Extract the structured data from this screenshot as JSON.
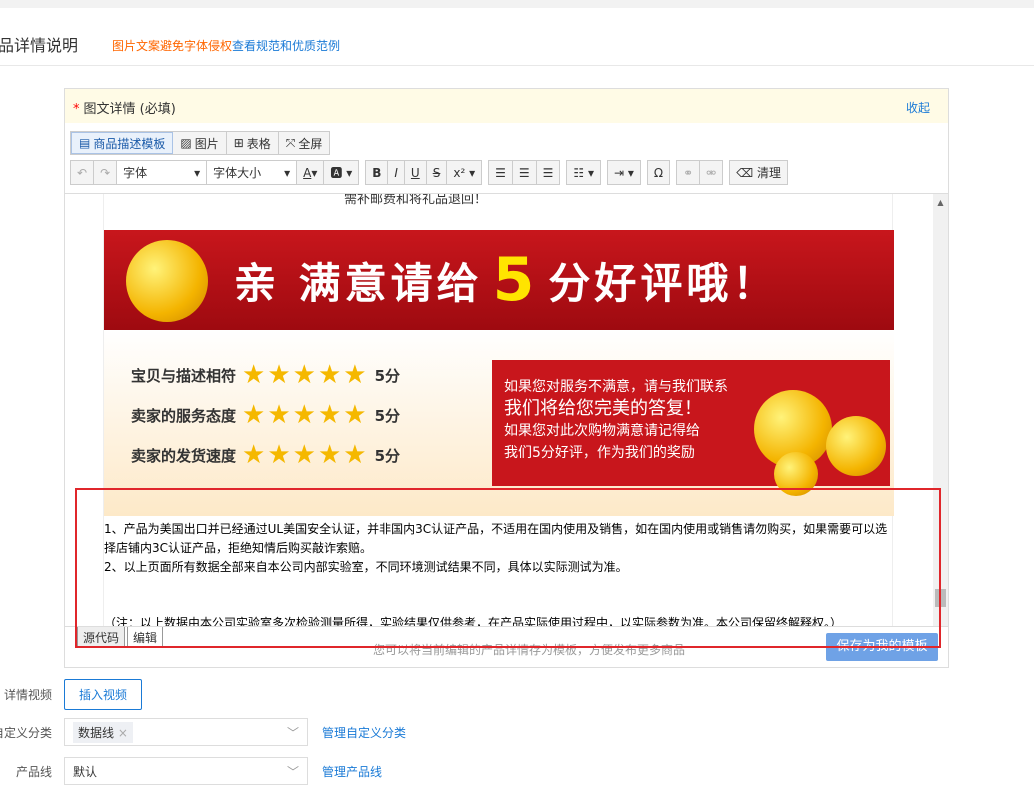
{
  "section": {
    "title": "品详情说明",
    "tip_warning": "图片文案避免字体侵权",
    "tip_link": "查看规范和优质范例"
  },
  "editor": {
    "label": "图文详情 (必填)",
    "required_mark": "*",
    "collapse": "收起",
    "toolbar1": [
      "商品描述模板",
      "图片",
      "表格",
      "全屏"
    ],
    "font_family": "字体",
    "font_size": "字体大小",
    "clear": "清理",
    "content": {
      "top_text": "需补邮费和将礼品退回！",
      "banner": {
        "part1": "亲 满意请给",
        "five": "5",
        "part2": "分好评哦！"
      },
      "ratings": [
        {
          "label": "宝贝与描述相符",
          "score": "5分",
          "stars": 5
        },
        {
          "label": "卖家的服务态度",
          "score": "5分",
          "stars": 5
        },
        {
          "label": "卖家的发货速度",
          "score": "5分",
          "stars": 5
        }
      ],
      "red_box": [
        "如果您对服务不满意，请与我们联系",
        "我们将给您完美的答复！",
        "如果您对此次购物满意请记得给",
        "我们5分好评，作为我们的奖励"
      ],
      "notes": [
        "1、产品为美国出口并已经通过UL美国安全认证，并非国内3C认证产品，不适用在国内使用及销售，如在国内使用或销售请勿购买，如果需要可以选择店铺内3C认证产品，拒绝知情后购买敲诈索赔。",
        "2、以上页面所有数据全部来自本公司内部实验室，不同环境测试结果不同，具体以实际测试为准。",
        "（注：以上数据由本公司实验室多次检验测量所得，实验结果仅供参考，在产品实际使用过程中，以实际参数为准。本公司保留终解释权。）"
      ]
    },
    "tabs": [
      "源代码",
      "编辑"
    ],
    "footer_tip": "您可以将当前编辑的产品详情存为模板，方便发布更多商品",
    "save_template": "保存为我的模板"
  },
  "form": {
    "video_label": "详情视频",
    "video_button": "插入视频",
    "category_label": "自定义分类",
    "category_chip": "数据线",
    "category_link": "管理自定义分类",
    "line_label": "产品线",
    "line_value": "默认",
    "line_link": "管理产品线"
  },
  "colors": {
    "accent": "#1a7ad6",
    "highlight": "#e0262b",
    "warning": "#ff6600"
  }
}
